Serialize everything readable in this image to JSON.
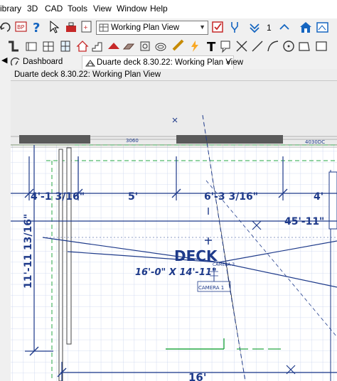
{
  "menu": [
    "ibrary",
    "3D",
    "CAD",
    "Tools",
    "View",
    "Window",
    "Help"
  ],
  "toolbar": {
    "view_selector": "Working Plan View",
    "counter": "1"
  },
  "tabs": {
    "dashboard": "Dashboard",
    "active": "Duarte deck 8.30.22:  Working Plan View",
    "close": "×"
  },
  "view_title": "Duarte deck 8.30.22:  Working Plan View",
  "plan": {
    "window_label_1": "3060",
    "window_label_2": "4030DC",
    "dims": [
      "4'-1 3/16\"",
      "5'",
      "6'-3 3/16\"",
      "4'"
    ],
    "overall_width": "45'-11\"",
    "height_dim": "11'-11 13/16\"",
    "room_name": "DECK",
    "room_size": "16'-0\" X 14'-11\"",
    "camera_top": "CAMERA 3",
    "camera_bottom": "CAMERA 1",
    "bottom_dim": "16'"
  },
  "colors": {
    "dimension_blue": "#1e3a8a",
    "grid_blue": "#c9d3ee",
    "wall_gray": "#555555"
  }
}
